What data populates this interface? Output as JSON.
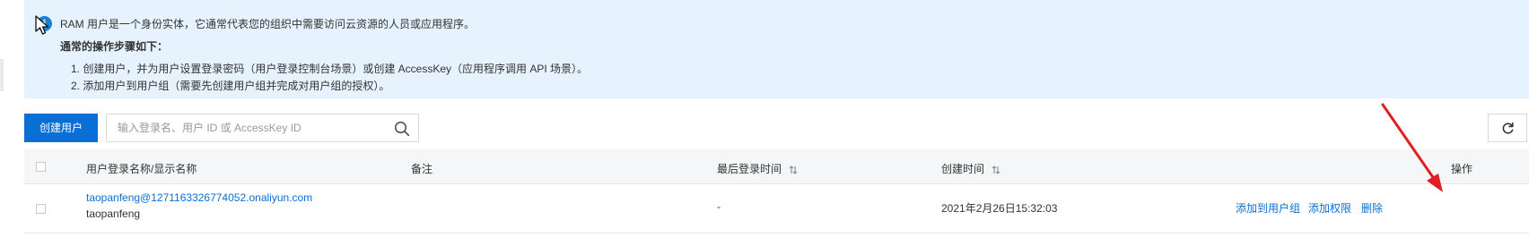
{
  "notice": {
    "line1": "RAM 用户是一个身份实体，它通常代表您的组织中需要访问云资源的人员或应用程序。",
    "line2": "通常的操作步骤如下：",
    "line3": "1. 创建用户，并为用户设置登录密码（用户登录控制台场景）或创建 AccessKey（应用程序调用 API 场景）。",
    "line4": "2. 添加用户到用户组（需要先创建用户组并完成对用户组的授权）。"
  },
  "toolbar": {
    "create_label": "创建用户",
    "search_placeholder": "输入登录名、用户 ID 或 AccessKey ID"
  },
  "table": {
    "columns": {
      "name": "用户登录名称/显示名称",
      "remark": "备注",
      "last_login": "最后登录时间",
      "created": "创建时间",
      "actions": "操作"
    },
    "rows": [
      {
        "login_name": "taopanfeng@1271163326774052.onaliyun.com",
        "display_name": "taopanfeng",
        "remark": "",
        "last_login": "-",
        "created": "2021年2月26日15:32:03",
        "action_add_group": "添加到用户组",
        "action_add_permission": "添加权限",
        "action_delete": "删除"
      }
    ]
  },
  "colors": {
    "accent": "#0a6fd4",
    "notice_bg": "#e6f3fe",
    "arrow": "#e02020"
  },
  "icons": [
    "info-icon",
    "cursor-icon",
    "search-icon",
    "refresh-icon",
    "sort-icon",
    "red-arrow-annotation"
  ]
}
